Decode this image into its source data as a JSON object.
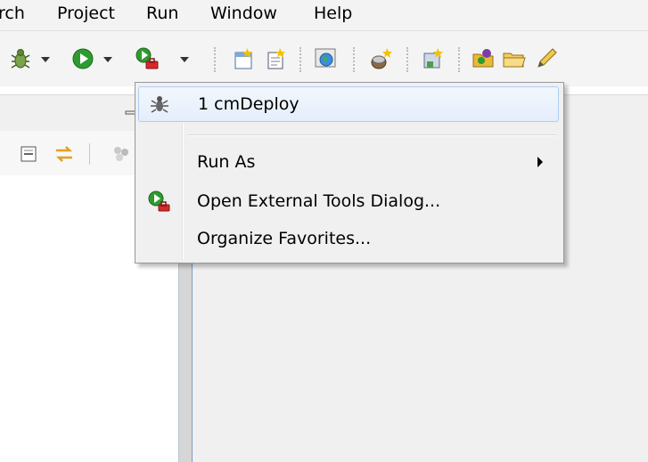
{
  "menubar": {
    "items": [
      "rch",
      "Project",
      "Run",
      "Window",
      "Help"
    ]
  },
  "toolbar": {
    "icons": [
      "debug-bug-icon",
      "run-play-icon",
      "external-tools-icon",
      "new-class-icon",
      "new-file-icon",
      "web-browser-icon",
      "server-icon",
      "deploy-icon",
      "open-folder-icon",
      "open-folder-2-icon",
      "edit-pencil-icon"
    ]
  },
  "dropdown": {
    "items": [
      {
        "label": "1 cmDeploy",
        "icon": "ant-bug-icon",
        "highlighted": true
      },
      {
        "label": "Run As",
        "submenu": true
      },
      {
        "label": "Open External Tools Dialog...",
        "icon": "external-tools-icon"
      },
      {
        "label": "Organize Favorites..."
      }
    ]
  },
  "colors": {
    "menu_bg": "#f0f0f0",
    "highlight_border": "#aecff7",
    "run_green": "#2e9b2e",
    "tool_red": "#d42a2a",
    "divider_blue": "#7f9db9"
  }
}
